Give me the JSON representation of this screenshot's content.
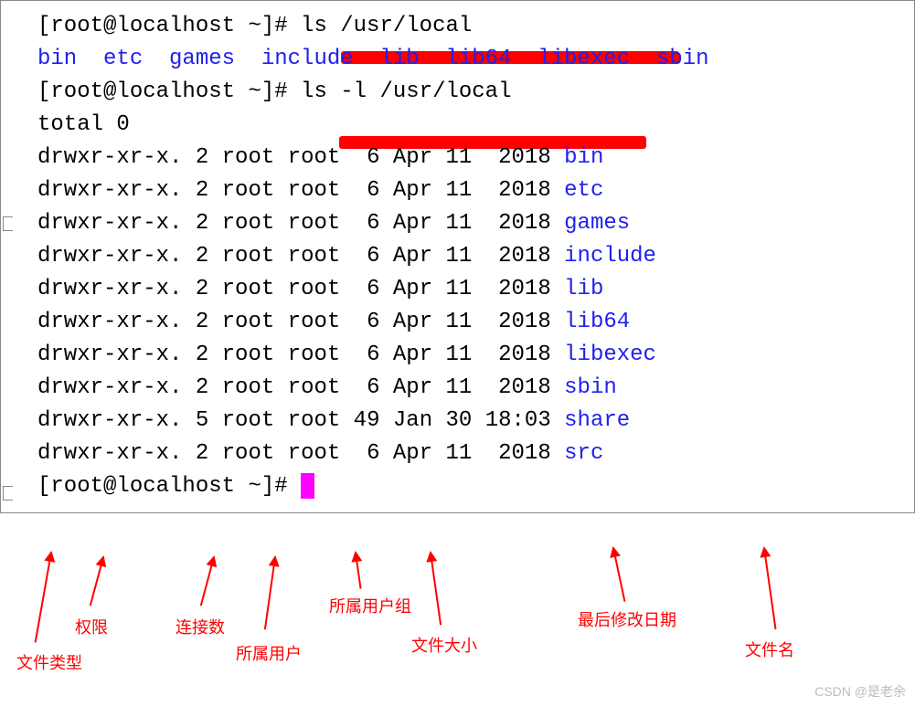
{
  "prompt": "[root@localhost ~]# ",
  "cmd1": "ls /usr/local",
  "cmd2": "ls -l /usr/local",
  "ls_output": "bin  etc  games  include  lib  lib64  libexec  sbin",
  "total": "total 0",
  "rows": [
    {
      "perm": "drwxr-xr-x.",
      "links": "2",
      "user": "root",
      "group": "root",
      "size": " 6",
      "date": "Apr 11  2018",
      "name": "bin"
    },
    {
      "perm": "drwxr-xr-x.",
      "links": "2",
      "user": "root",
      "group": "root",
      "size": " 6",
      "date": "Apr 11  2018",
      "name": "etc"
    },
    {
      "perm": "drwxr-xr-x.",
      "links": "2",
      "user": "root",
      "group": "root",
      "size": " 6",
      "date": "Apr 11  2018",
      "name": "games"
    },
    {
      "perm": "drwxr-xr-x.",
      "links": "2",
      "user": "root",
      "group": "root",
      "size": " 6",
      "date": "Apr 11  2018",
      "name": "include"
    },
    {
      "perm": "drwxr-xr-x.",
      "links": "2",
      "user": "root",
      "group": "root",
      "size": " 6",
      "date": "Apr 11  2018",
      "name": "lib"
    },
    {
      "perm": "drwxr-xr-x.",
      "links": "2",
      "user": "root",
      "group": "root",
      "size": " 6",
      "date": "Apr 11  2018",
      "name": "lib64"
    },
    {
      "perm": "drwxr-xr-x.",
      "links": "2",
      "user": "root",
      "group": "root",
      "size": " 6",
      "date": "Apr 11  2018",
      "name": "libexec"
    },
    {
      "perm": "drwxr-xr-x.",
      "links": "2",
      "user": "root",
      "group": "root",
      "size": " 6",
      "date": "Apr 11  2018",
      "name": "sbin"
    },
    {
      "perm": "drwxr-xr-x.",
      "links": "5",
      "user": "root",
      "group": "root",
      "size": "49",
      "date": "Jan 30 18:03",
      "name": "share"
    },
    {
      "perm": "drwxr-xr-x.",
      "links": "2",
      "user": "root",
      "group": "root",
      "size": " 6",
      "date": "Apr 11  2018",
      "name": "src"
    }
  ],
  "labels": {
    "filetype": "文件类型",
    "perm": "权限",
    "links": "连接数",
    "user": "所属用户",
    "group": "所属用户组",
    "size": "文件大小",
    "mdate": "最后修改日期",
    "fname": "文件名"
  },
  "watermark": "CSDN @是老余"
}
